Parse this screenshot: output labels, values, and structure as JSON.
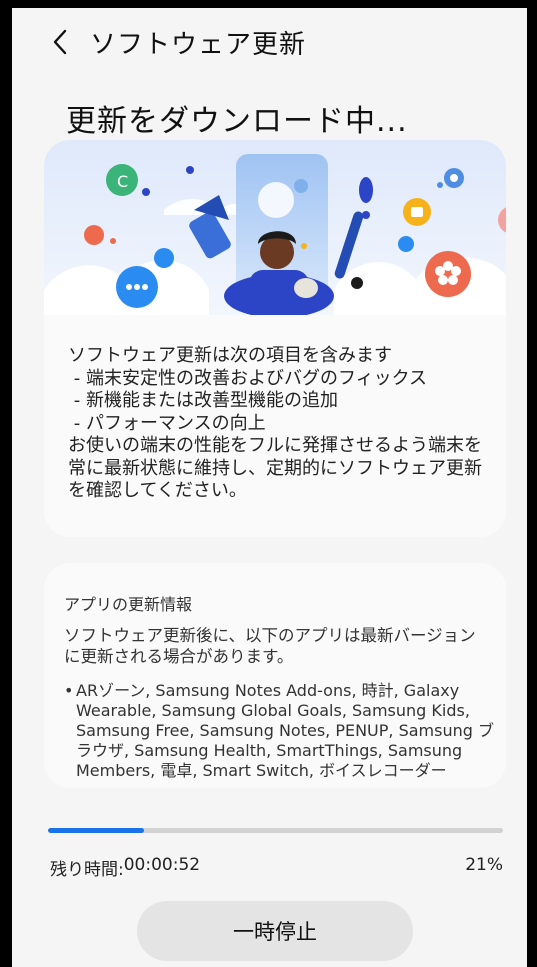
{
  "header": {
    "title": "ソフトウェア更新"
  },
  "page_title": "更新をダウンロード中...",
  "update_info": {
    "text": "ソフトウェア更新は次の項目を含みます\n - 端末安定性の改善およびバグのフィックス\n - 新機能または改善型機能の追加\n - パフォーマンスの向上\nお使いの端末の性能をフルに発揮させるよう端末を常に最新状態に維持し、定期的にソフトウェア更新を確認してください。"
  },
  "apps_update": {
    "heading": "アプリの更新情報",
    "description": "ソフトウェア更新後に、以下のアプリは最新バージョンに更新される場合があります。",
    "bullet": "•",
    "apps": "ARゾーン, Samsung Notes Add-ons, 時計, Galaxy Wearable, Samsung Global Goals, Samsung Kids, Samsung Free, Samsung Notes, PENUP, Samsung ブラウザ, Samsung Health, SmartThings, Samsung Members, 電卓, Smart Switch, ボイスレコーダー"
  },
  "progress": {
    "value": 0.21,
    "remaining_label": "残り時間: ",
    "remaining_time": "00:00:52",
    "percent_text": "21%"
  },
  "pause_label": "一時停止",
  "colors": {
    "accent": "#1a73e8",
    "background": "#f5f5f5",
    "card": "#fafafa"
  }
}
